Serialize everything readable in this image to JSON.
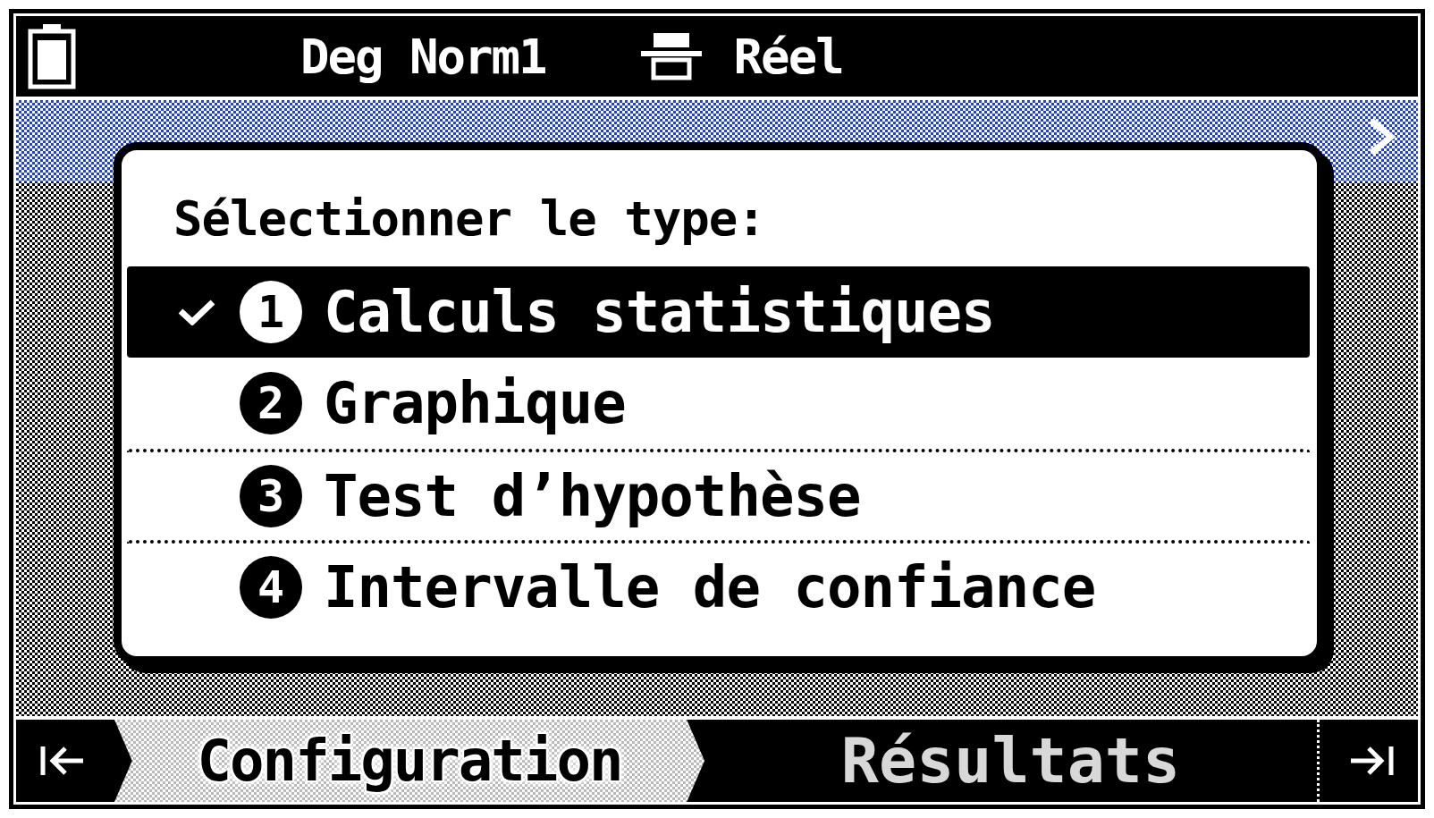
{
  "status_bar": {
    "mode": "Deg Norm1",
    "number_format": "Réel"
  },
  "dialog": {
    "title": "Sélectionner le type:",
    "items": [
      {
        "number": "1",
        "label": "Calculs statistiques",
        "selected": true,
        "divider_above": false
      },
      {
        "number": "2",
        "label": "Graphique",
        "selected": false,
        "divider_above": false
      },
      {
        "number": "3",
        "label": "Test d’hypothèse",
        "selected": false,
        "divider_above": true
      },
      {
        "number": "4",
        "label": "Intervalle de confiance",
        "selected": false,
        "divider_above": true
      }
    ]
  },
  "bottom_tabs": [
    {
      "label": "Configuration",
      "selected": true
    },
    {
      "label": "Résultats",
      "selected": false
    }
  ]
}
